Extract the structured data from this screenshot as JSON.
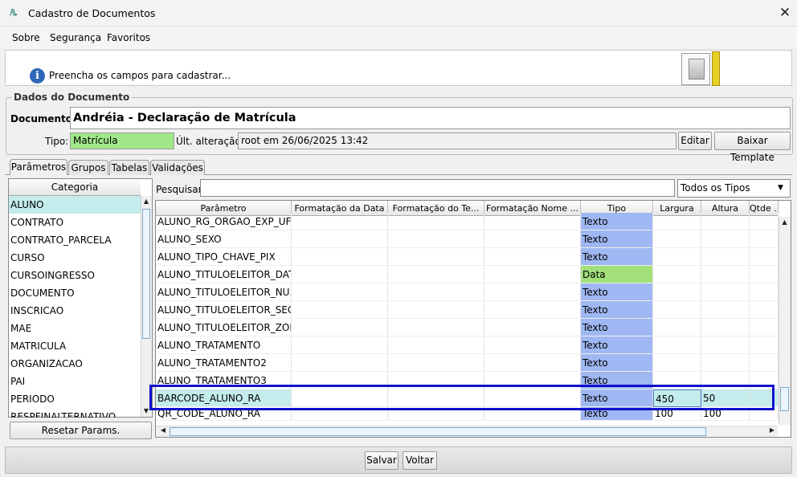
{
  "window": {
    "title": "Cadastro de Documentos",
    "icon": "app-logo-icon",
    "close_label": "✕"
  },
  "menu": [
    {
      "label": "Sobre"
    },
    {
      "label": "Segurança"
    },
    {
      "label": "Favoritos"
    }
  ],
  "info": {
    "text": "Preencha os campos para cadastrar...",
    "icon": "info-icon"
  },
  "dados": {
    "legend": "Dados do Documento",
    "documento_label": "Documento:",
    "documento_value": "Andréia - Declaração de Matrícula",
    "tipo_label": "Tipo:",
    "tipo_value": "Matrícula",
    "tipo_color": "#a0e88a",
    "ult_label": "Últ. alteração:",
    "ult_value": "root em 26/06/2025 13:42",
    "editar_label": "Editar",
    "baixar_label": "Baixar Template"
  },
  "tabs": [
    {
      "label": "Parâmetros",
      "active": true
    },
    {
      "label": "Grupos",
      "active": false
    },
    {
      "label": "Tabelas",
      "active": false
    },
    {
      "label": "Validações",
      "active": false
    }
  ],
  "categorias": {
    "header": "Categoria",
    "items": [
      {
        "label": "ALUNO",
        "selected": true
      },
      {
        "label": "CONTRATO"
      },
      {
        "label": "CONTRATO_PARCELA"
      },
      {
        "label": "CURSO"
      },
      {
        "label": "CURSOINGRESSO"
      },
      {
        "label": "DOCUMENTO"
      },
      {
        "label": "INSCRICAO"
      },
      {
        "label": "MAE"
      },
      {
        "label": "MATRICULA"
      },
      {
        "label": "ORGANIZACAO"
      },
      {
        "label": "PAI"
      },
      {
        "label": "PERIODO"
      },
      {
        "label": "RESPFINALTERNATIVO"
      }
    ],
    "reset_label": "Resetar Params."
  },
  "search": {
    "label": "Pesquisar:",
    "value": "",
    "filter_value": "Todos os Tipos"
  },
  "grid": {
    "columns": [
      "Parâmetro",
      "Formatação da Data",
      "Formatação do Te...",
      "Formatação Nome ...",
      "Tipo",
      "Largura",
      "Altura",
      "Qtde ..."
    ],
    "rows": [
      {
        "param": "ALUNO_RG_ORGAO_EXP_UF",
        "tipo": "Texto",
        "largura": "",
        "altura": ""
      },
      {
        "param": "ALUNO_SEXO",
        "tipo": "Texto",
        "largura": "",
        "altura": ""
      },
      {
        "param": "ALUNO_TIPO_CHAVE_PIX",
        "tipo": "Texto",
        "largura": "",
        "altura": ""
      },
      {
        "param": "ALUNO_TITULOELEITOR_DAT...",
        "tipo": "Data",
        "largura": "",
        "altura": ""
      },
      {
        "param": "ALUNO_TITULOELEITOR_NU...",
        "tipo": "Texto",
        "largura": "",
        "altura": ""
      },
      {
        "param": "ALUNO_TITULOELEITOR_SEC...",
        "tipo": "Texto",
        "largura": "",
        "altura": ""
      },
      {
        "param": "ALUNO_TITULOELEITOR_ZONA",
        "tipo": "Texto",
        "largura": "",
        "altura": ""
      },
      {
        "param": "ALUNO_TRATAMENTO",
        "tipo": "Texto",
        "largura": "",
        "altura": ""
      },
      {
        "param": "ALUNO_TRATAMENTO2",
        "tipo": "Texto",
        "largura": "",
        "altura": ""
      },
      {
        "param": "ALUNO_TRATAMENTO3",
        "tipo": "Texto",
        "largura": "",
        "altura": ""
      },
      {
        "param": "BARCODE_ALUNO_RA",
        "tipo": "Texto",
        "largura": "450",
        "altura": "50",
        "selected": true
      },
      {
        "param": "QR_CODE_ALUNO_RA",
        "tipo": "Texto",
        "largura": "100",
        "altura": "100"
      }
    ],
    "colors": {
      "texto": "#9fb7f2",
      "data": "#a2e07c",
      "selected": "#c4ecec",
      "highlight": "#1111cc"
    }
  },
  "footer": {
    "salvar_label": "Salvar",
    "voltar_label": "Voltar"
  }
}
